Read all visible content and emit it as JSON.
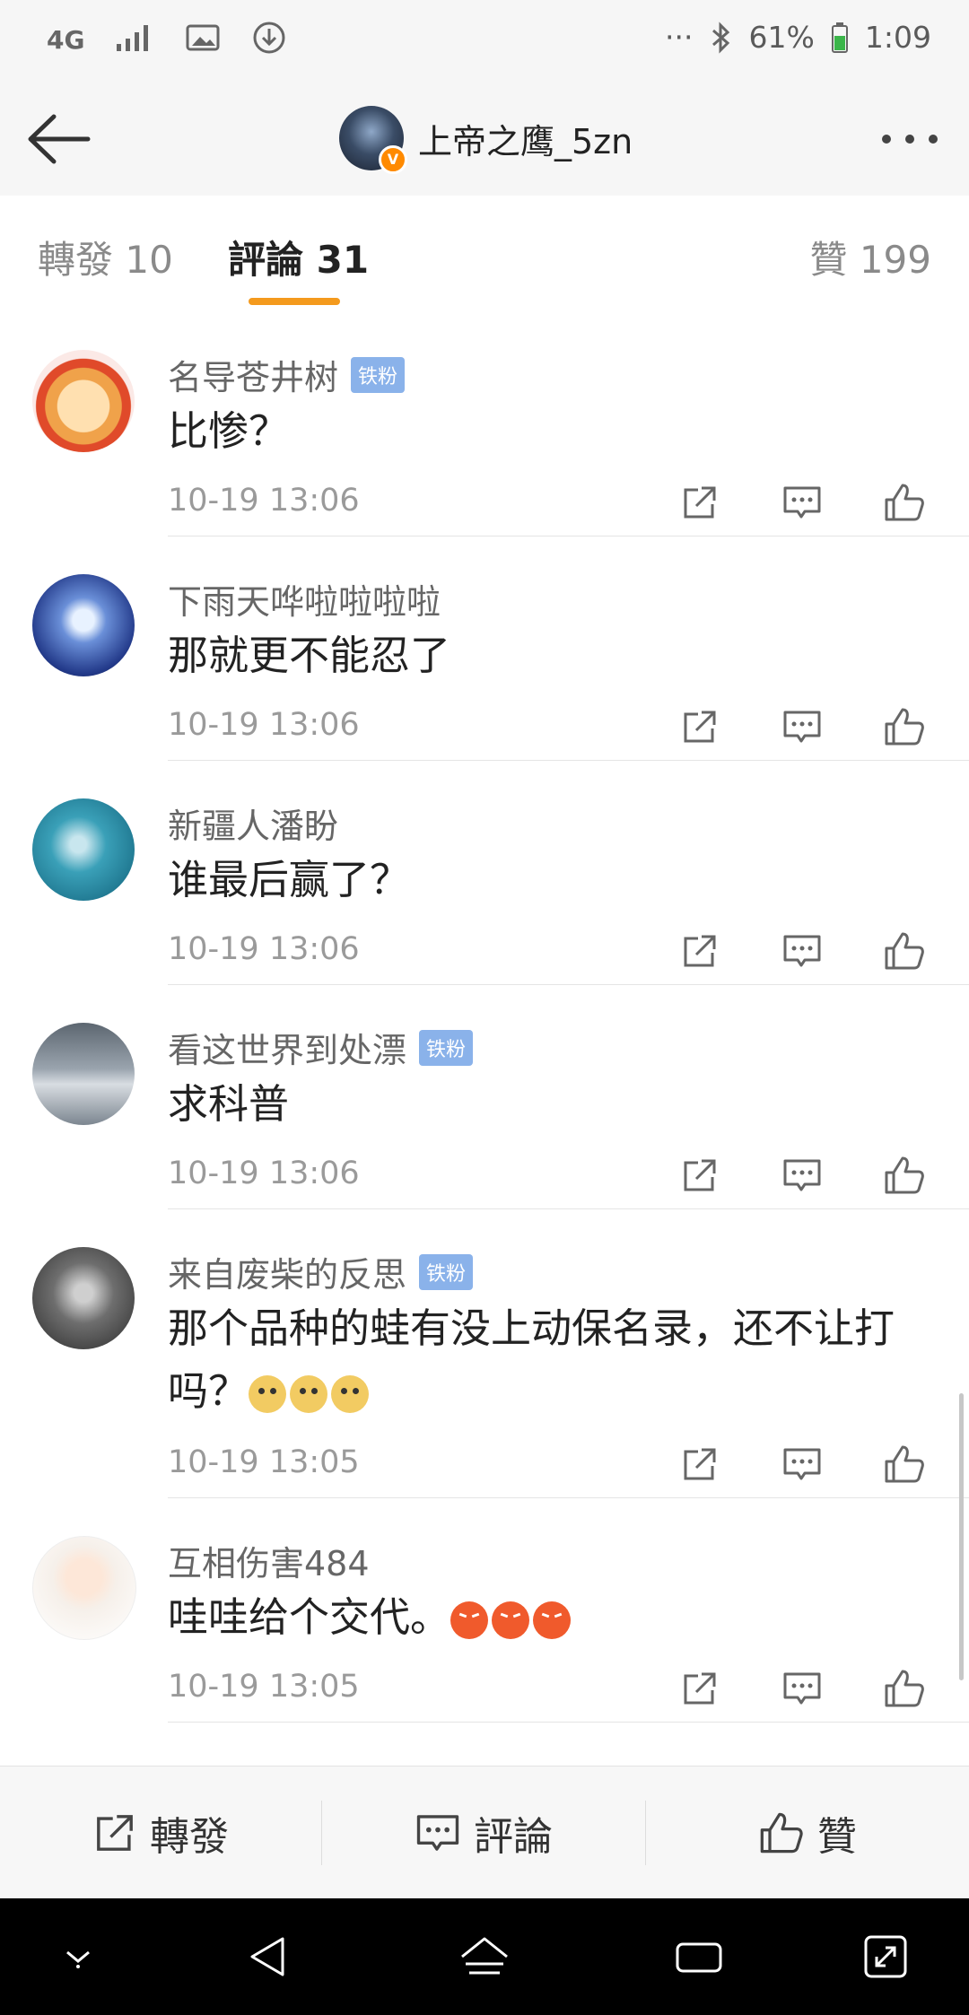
{
  "status_bar": {
    "network": "4G",
    "battery": "61%",
    "time": "1:09",
    "overflow": "···"
  },
  "header": {
    "title": "上帝之鹰_5zn",
    "verified_badge": "V"
  },
  "tabs": [
    {
      "label": "轉發 10"
    },
    {
      "label": "評論 31"
    },
    {
      "label": "贊 199"
    }
  ],
  "comments": [
    {
      "name": "名导苍井树",
      "badge": "铁粉",
      "text": "比惨？",
      "emojis": [],
      "time": "10-19 13:06"
    },
    {
      "name": "下雨天哗啦啦啦啦",
      "badge": "",
      "text": "那就更不能忍了",
      "emojis": [],
      "time": "10-19 13:06"
    },
    {
      "name": "新疆人潘盼",
      "badge": "",
      "text": "谁最后赢了？",
      "emojis": [],
      "time": "10-19 13:06"
    },
    {
      "name": "看这世界到处漂",
      "badge": "铁粉",
      "text": "求科普",
      "emojis": [],
      "time": "10-19 13:06"
    },
    {
      "name": "来自废柴的反思",
      "badge": "铁粉",
      "text": "那个品种的蛙有没上动保名录，还不让打吗？",
      "emojis": [
        "doge",
        "doge",
        "doge"
      ],
      "time": "10-19 13:05"
    },
    {
      "name": "互相伤害484",
      "badge": "",
      "text": "哇哇给个交代。",
      "emojis": [
        "angry",
        "angry",
        "angry"
      ],
      "time": "10-19 13:05"
    }
  ],
  "bottom_bar": {
    "repost": "轉發",
    "comment": "評論",
    "like": "贊"
  },
  "colors": {
    "accent": "#f49a1d",
    "fan_badge": "#8ab2ea"
  }
}
